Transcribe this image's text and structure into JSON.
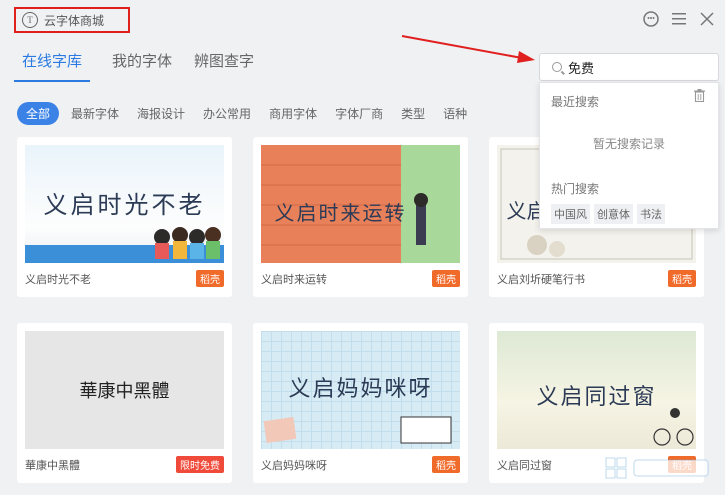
{
  "window": {
    "title": "云字体商城",
    "icons": [
      "cloud-icon",
      "smile-icon",
      "menu-icon",
      "close-icon"
    ]
  },
  "tabs": [
    {
      "label": "在线字库",
      "active": true
    },
    {
      "label": "我的字体",
      "active": false
    },
    {
      "label": "辨图查字",
      "active": false
    }
  ],
  "search": {
    "value": "免费",
    "placeholder": ""
  },
  "categories": [
    "全部",
    "最新字体",
    "海报设计",
    "办公常用",
    "商用字体",
    "字体厂商",
    "类型",
    "语种"
  ],
  "dropdown": {
    "recent_label": "最近搜索",
    "empty_text": "暂无搜索记录",
    "hot_label": "热门搜索",
    "hot_tags": [
      "中国风",
      "创意体",
      "书法"
    ]
  },
  "cards": [
    {
      "name": "义启时光不老",
      "preview": "义启时光不老",
      "badge": "稻壳"
    },
    {
      "name": "义启时来运转",
      "preview": "义启时来运转",
      "badge": "稻壳"
    },
    {
      "name": "义启刘圻硬笔行书",
      "preview": "义启",
      "badge": "稻壳"
    },
    {
      "name": "華康中黑體",
      "preview": "華康中黑體",
      "badge": "限时免费"
    },
    {
      "name": "义启妈妈咪呀",
      "preview": "义启妈妈咪呀",
      "badge": "稻壳"
    },
    {
      "name": "义启同过窗",
      "preview": "义启同过窗",
      "badge": "稻壳"
    }
  ],
  "colors": {
    "accent": "#2a7ae2",
    "badge": "#f06a2a",
    "highlight_box": "#e0201f"
  }
}
